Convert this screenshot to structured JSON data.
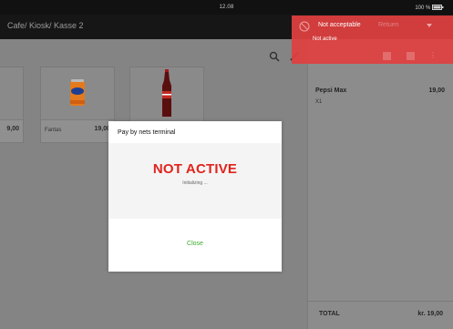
{
  "status_bar": {
    "time": "12.08",
    "battery": "100 %"
  },
  "header": {
    "breadcrumb": "Cafe/ Kiosk/ Kasse 2"
  },
  "products": [
    {
      "name": "",
      "price": "9,00",
      "icon": "product-image"
    },
    {
      "name": "Fantas",
      "price": "19,00",
      "icon": "fanta-can"
    },
    {
      "name": "",
      "price": "",
      "icon": "coca-cola-bottle"
    }
  ],
  "order": {
    "items": [
      {
        "name": "Pepsi Max",
        "qty": "X1",
        "price": "19,00"
      }
    ],
    "total_label": "TOTAL",
    "total_value": "kr. 19,00"
  },
  "toast": {
    "title": "Not acceptable",
    "message": "Not active",
    "behind_text": "Retuen"
  },
  "modal": {
    "title": "Pay by nets terminal",
    "status": "NOT ACTIVE",
    "substatus": "Initializing ...",
    "close": "Close"
  },
  "colors": {
    "toast_bg": "#e04040",
    "status_red": "#e1231c",
    "close_green": "#3aab2f"
  }
}
